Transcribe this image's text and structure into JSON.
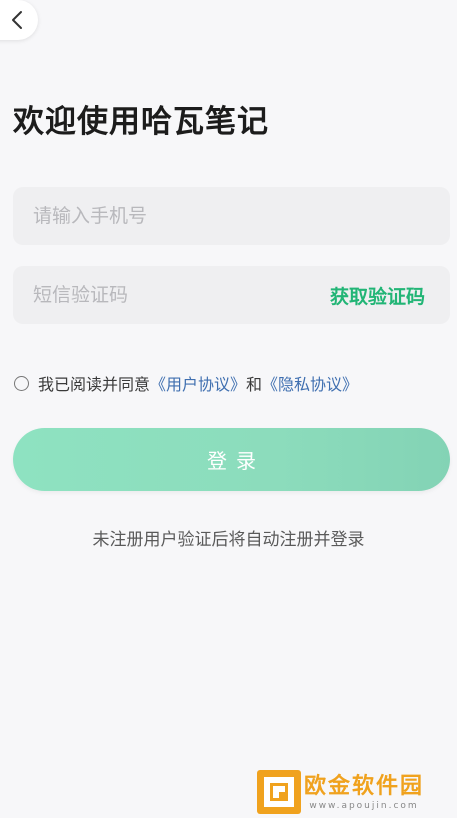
{
  "nav": {
    "back_icon": "chevron-left-icon"
  },
  "header": {
    "title": "欢迎使用哈瓦笔记"
  },
  "form": {
    "phone_placeholder": "请输入手机号",
    "phone_value": "",
    "code_placeholder": "短信验证码",
    "code_value": "",
    "get_code_label": "获取验证码"
  },
  "agreement": {
    "checked": false,
    "prefix": "我已阅读并同意",
    "user_agreement": "《用户协议》",
    "connector": "和",
    "privacy_policy": "《隐私协议》"
  },
  "login": {
    "label": "登录"
  },
  "note": "未注册用户验证后将自动注册并登录",
  "watermark": {
    "name": "欧金软件园",
    "site": "www.apoujin.com"
  },
  "colors": {
    "background": "#f7f7f9",
    "accent": "#22b576",
    "button": "#8ee2c1",
    "link": "#3f6fb0",
    "watermark": "#f0a21e"
  }
}
